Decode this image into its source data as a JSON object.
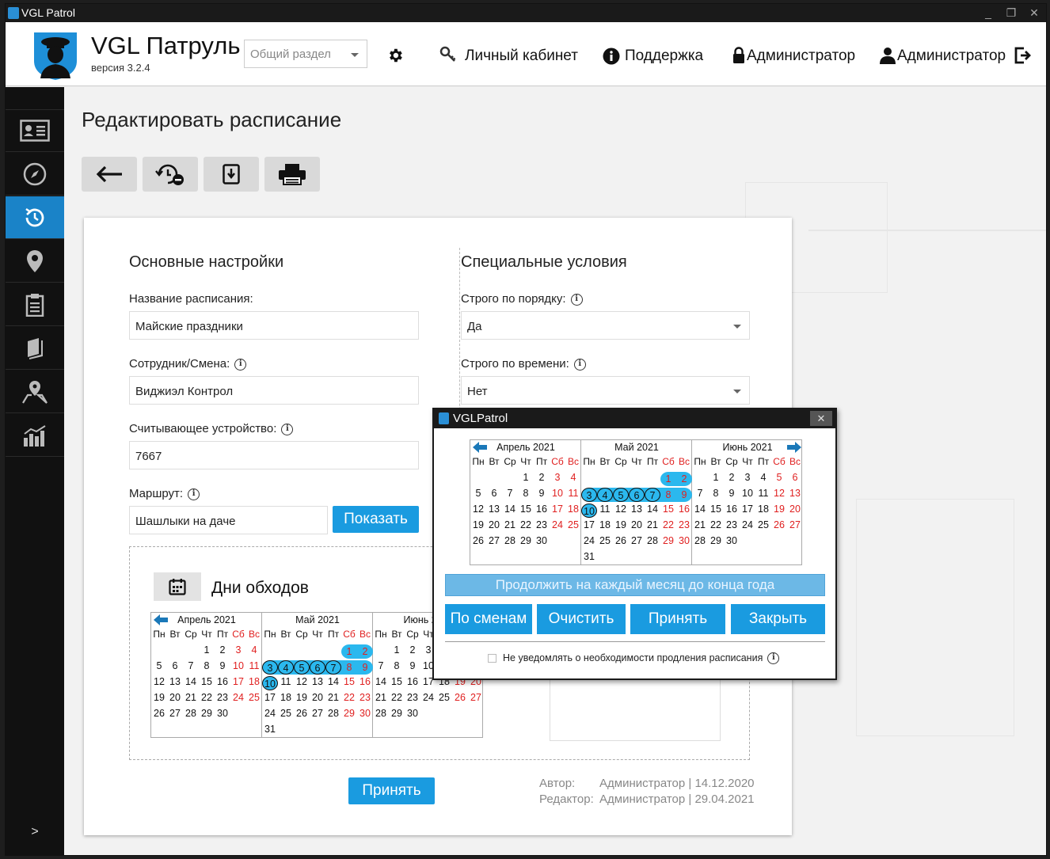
{
  "window": {
    "title": "VGL Patrol",
    "minimize": "_",
    "maximize": "❐",
    "close": "✕"
  },
  "header": {
    "app_name": "VGL Патруль",
    "version": "версия 3.2.4",
    "section_placeholder": "Общий раздел",
    "links": {
      "cabinet": "Личный кабинет",
      "support": "Поддержка",
      "admin_lock": "Администратор",
      "admin_user": "Администратор"
    }
  },
  "sidebar": {
    "more": ">"
  },
  "page": {
    "title": "Редактировать расписание"
  },
  "basic": {
    "title": "Основные настройки",
    "name_label": "Название расписания:",
    "name_value": "Майские праздники",
    "employee_label": "Сотрудник/Смена:",
    "employee_value": "Виджиэл Контрол",
    "reader_label": "Считывающее устройство:",
    "reader_value": "7667",
    "route_label": "Маршрут:",
    "route_value": "Шашлыки на даче",
    "show_button": "Показать"
  },
  "special": {
    "title": "Специальные условия",
    "order_label": "Строго по порядку:",
    "order_value": "Да",
    "time_label": "Строго по времени:",
    "time_value": "Нет"
  },
  "days": {
    "title": "Дни обходов"
  },
  "footer": {
    "accept": "Принять",
    "author_label": "Автор:",
    "author_value": "Администратор | 14.12.2020",
    "editor_label": "Редактор:",
    "editor_value": "Администратор | 29.04.2021"
  },
  "weekdays": [
    "Пн",
    "Вт",
    "Ср",
    "Чт",
    "Пт",
    "Сб",
    "Вс"
  ],
  "calendar_main": {
    "months": [
      {
        "name": "Апрель 2021",
        "offset": 3,
        "days": 30,
        "selected": []
      },
      {
        "name": "Май 2021",
        "offset": 5,
        "days": 31,
        "selected": [
          1,
          2,
          3,
          4,
          5,
          6,
          7,
          8,
          9,
          10
        ]
      },
      {
        "name": "Июнь 2021",
        "offset": 1,
        "days": 30,
        "selected": []
      }
    ]
  },
  "popup": {
    "title": "VGLPatrol",
    "close": "✕",
    "continue": "Продолжить на каждый месяц до конца года",
    "by_shifts": "По сменам",
    "clear": "Очистить",
    "accept": "Принять",
    "close_btn": "Закрыть",
    "no_notify": "Не уведомлять о необходимости продления расписания"
  },
  "colors": {
    "accent": "#1a9be0",
    "selected_day": "#2bb8ee",
    "weekend": "#e02020",
    "sidebar": "#111111"
  }
}
